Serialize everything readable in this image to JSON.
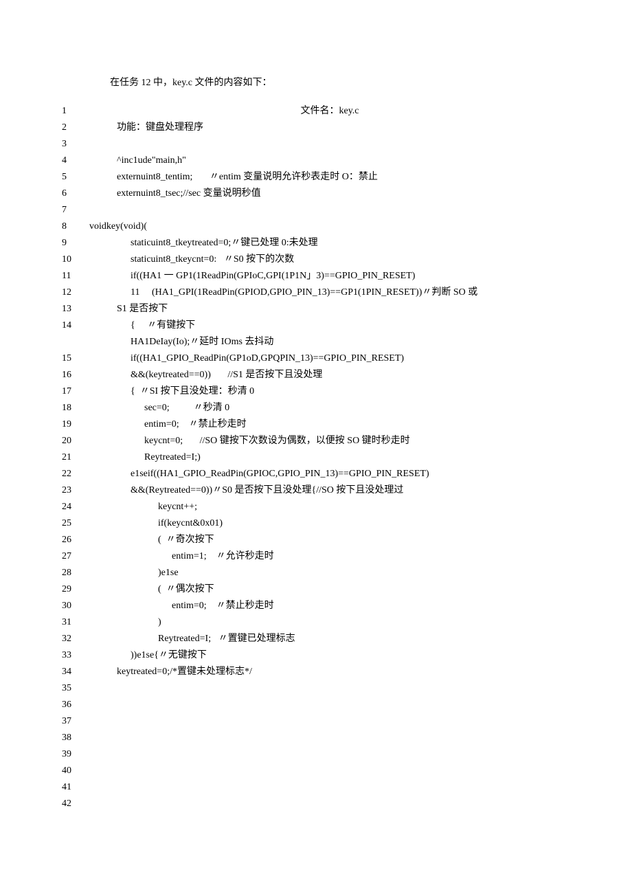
{
  "intro": "在任务 12 中，key.c 文件的内容如下：",
  "line_numbers": [
    "1",
    "2",
    "3",
    "4",
    "5",
    "6",
    "7",
    "8",
    "9",
    "10",
    "11",
    "12",
    "13",
    "14",
    "",
    "15",
    "16",
    "17",
    "18",
    "19",
    "20",
    "21",
    "22",
    "23",
    "24",
    "25",
    "26",
    "27",
    "28",
    "29",
    "30",
    "31",
    "32",
    "33",
    "34",
    "35",
    "36",
    "37",
    "38",
    "39",
    "40",
    "41",
    "42"
  ],
  "lines": {
    "l1": "文件名：key.c",
    "l2": "功能：键盘处理程序",
    "l3": "",
    "l4": "^inc1ude\"main,h\"",
    "l5": "externuint8_tentim;       〃entim 变量说明允许秒表走时 O：禁止",
    "l6": "externuint8_tsec;//sec 变量说明秒值",
    "l7": "",
    "l8": "voidkey(void)(",
    "l9": "staticuint8_tkeytreated=0;〃键已处理 0:未处理",
    "l10": "staticuint8_tkeycnt=0:   〃S0 按下的次数",
    "l11": "if((HA1 一 GP1(1ReadPin(GPIoC,GPI(1P1N」3)==GPIO_PIN_RESET)",
    "l12": "11     (HA1_GPI(1ReadPin(GPIOD,GPIO_PIN_13)==GP1(1PIN_RESET))〃判断 SO 或",
    "l13": "S1 是否按下",
    "l14": "{     〃有键按下",
    "l14b": "HA1DeIay(Io);〃延时 IOms 去抖动",
    "l15": "if((HA1_GPIO_ReadPin(GP1oD,GPQPIN_13)==GPIO_PIN_RESET)",
    "l16": "&&(keytreated==0))       //S1 是否按下且没处理",
    "l17": "{  〃SI 按下且没处理：秒清 0",
    "l18": "sec=0;          〃秒清 0",
    "l19": "entim=0;    〃禁止秒走时",
    "l20": "keycnt=0;       //SO 键按下次数设为偶数，以便按 SO 键时秒走时",
    "l21": "Reytreated=I;)",
    "l22": "e1seif((HA1_GPIO_ReadPin(GPIOC,GPIO_PIN_13)==GPIO_PIN_RESET)",
    "l23": "&&(Reytreated==0))〃S0 是否按下且没处理{//SO 按下且没处理过",
    "l24": "keycnt++;",
    "l25": "if(keycnt&0x01)",
    "l26": "(  〃奇次按下",
    "l27": "entim=1;    〃允许秒走时",
    "l28": ")e1se",
    "l29": "(  〃偶次按下",
    "l30": "entim=0;    〃禁止秒走时",
    "l31": ")",
    "l32": "Reytreated=I;   〃置键已处理标志",
    "l33": "))e1se{〃无键按下",
    "l34": "keytreated=0;/*置键未处理标志*/"
  }
}
